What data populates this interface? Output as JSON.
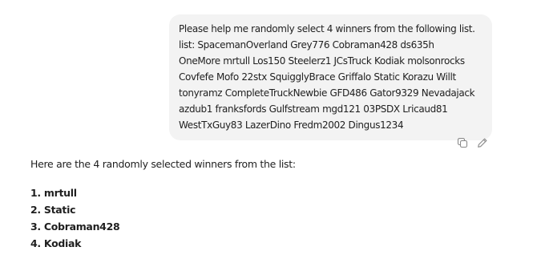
{
  "user_message": {
    "lines": [
      "Please help me randomly select 4 winners from the following list.",
      " list:   SpacemanOverland Grey776 Cobraman428 ds635h",
      "OneMore mrtull Los150 Steelerz1 JCsTruck Kodiak molsonrocks",
      "Covfefe Mofo 22stx SquigglyBrace Griffalo Static Korazu Willt",
      "tonyramz CompleteTruckNewbie GFD486 Gator9329 Nevadajack",
      "azdub1 franksfords Gulfstream mgd121 03PSDX Lricaud81",
      "WestTxGuy83 LazerDino Fredm2002 Dingus1234"
    ]
  },
  "message_actions": {
    "copy_icon": "copy-icon",
    "edit_icon": "edit-pencil-icon"
  },
  "assistant_message": {
    "intro": "Here are the 4 randomly selected winners from the list:",
    "winners": [
      "1. mrtull",
      "2. Static",
      "3. Cobraman428",
      "4. Kodiak"
    ]
  }
}
